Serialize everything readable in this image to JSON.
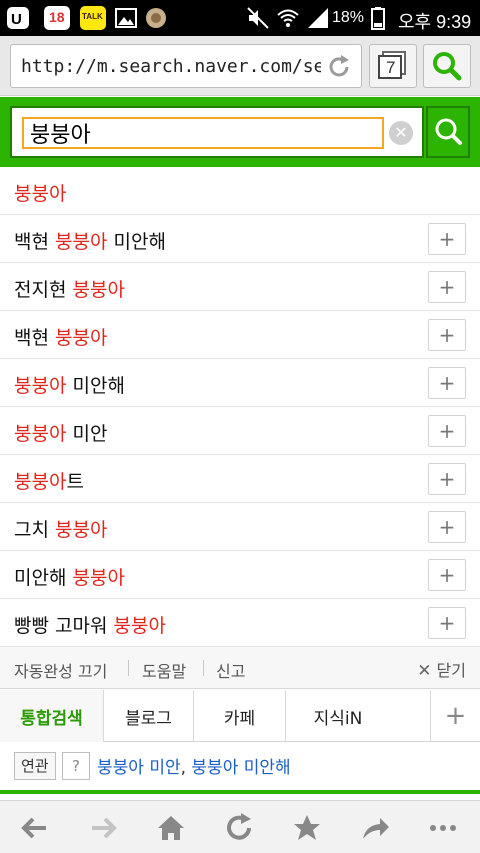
{
  "status_bar": {
    "notification_badge": "18",
    "talk_label": "TALK",
    "battery": "18%",
    "time": "오후 9:39"
  },
  "browser": {
    "url": "http://m.search.naver.com/sear...",
    "tab_count": "7"
  },
  "search": {
    "query": "붕붕아"
  },
  "suggestions": [
    {
      "parts": [
        {
          "t": "붕붕아",
          "h": true
        }
      ],
      "plus": false
    },
    {
      "parts": [
        {
          "t": "백현 ",
          "h": false
        },
        {
          "t": "붕붕아",
          "h": true
        },
        {
          "t": " 미안해",
          "h": false
        }
      ],
      "plus": true
    },
    {
      "parts": [
        {
          "t": "전지현 ",
          "h": false
        },
        {
          "t": "붕붕아",
          "h": true
        }
      ],
      "plus": true
    },
    {
      "parts": [
        {
          "t": "백현 ",
          "h": false
        },
        {
          "t": "붕붕아",
          "h": true
        }
      ],
      "plus": true
    },
    {
      "parts": [
        {
          "t": "붕붕아",
          "h": true
        },
        {
          "t": " 미안해",
          "h": false
        }
      ],
      "plus": true
    },
    {
      "parts": [
        {
          "t": "붕붕아",
          "h": true
        },
        {
          "t": " 미안",
          "h": false
        }
      ],
      "plus": true
    },
    {
      "parts": [
        {
          "t": "붕붕아",
          "h": true
        },
        {
          "t": "트",
          "h": false
        }
      ],
      "plus": true
    },
    {
      "parts": [
        {
          "t": "그치 ",
          "h": false
        },
        {
          "t": "붕붕아",
          "h": true
        }
      ],
      "plus": true
    },
    {
      "parts": [
        {
          "t": "미안해 ",
          "h": false
        },
        {
          "t": "붕붕아",
          "h": true
        }
      ],
      "plus": true
    },
    {
      "parts": [
        {
          "t": "빵빵 고마워 ",
          "h": false
        },
        {
          "t": "붕붕아",
          "h": true
        }
      ],
      "plus": true
    }
  ],
  "options": {
    "autocomplete_off": "자동완성 끄기",
    "help": "도움말",
    "report": "신고",
    "close": "닫기"
  },
  "tabs": [
    {
      "label": "통합검색",
      "active": true
    },
    {
      "label": "블로그",
      "active": false
    },
    {
      "label": "카페",
      "active": false
    },
    {
      "label": "지식iN",
      "active": false
    }
  ],
  "related": {
    "badge": "연관",
    "help": "?",
    "link1": "붕붕아 미안",
    "comma": ", ",
    "link2": "붕붕아 미안해"
  },
  "colors": {
    "naver_green": "#2db400",
    "highlight_red": "#e4261c",
    "link_blue": "#1a5fc5"
  }
}
